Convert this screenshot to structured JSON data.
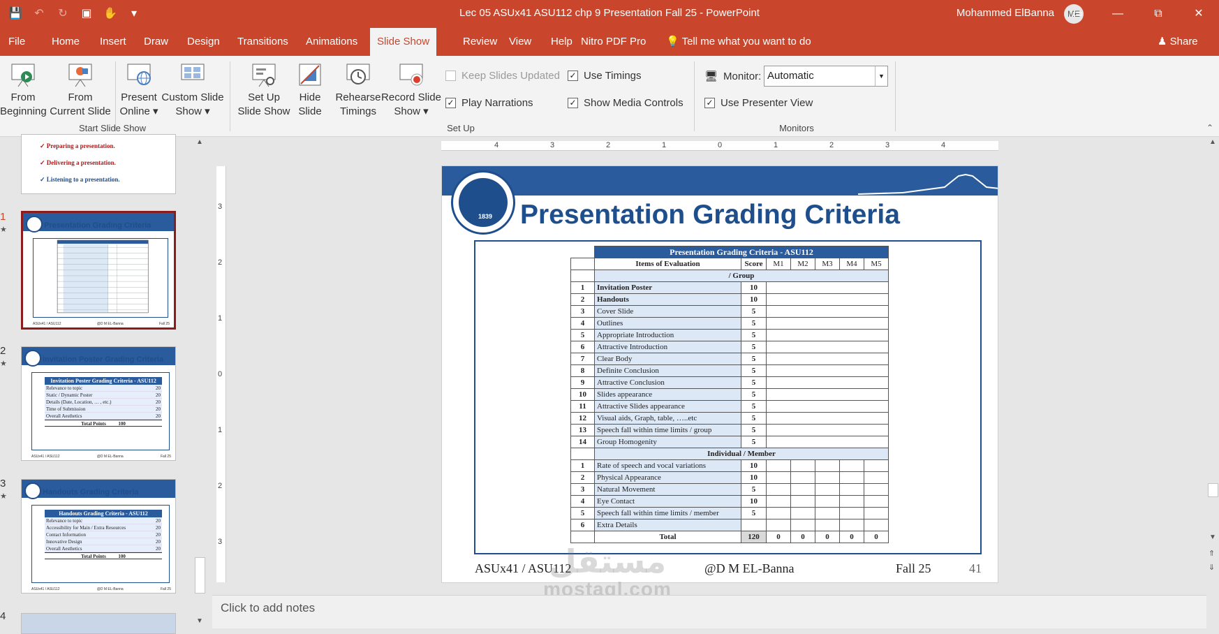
{
  "window": {
    "title": "Lec 05 ASUx41 ASU112 chp 9 Presentation Fall 25  -  PowerPoint",
    "user": "Mohammed ElBanna",
    "initials": "ME"
  },
  "tabs": [
    "File",
    "Home",
    "Insert",
    "Draw",
    "Design",
    "Transitions",
    "Animations",
    "Slide Show",
    "Review",
    "View",
    "Help",
    "Nitro PDF Pro"
  ],
  "active_tab": "Slide Show",
  "tell_me": "Tell me what you want to do",
  "share": "Share",
  "ribbon": {
    "from_beginning": [
      "From",
      "Beginning"
    ],
    "from_current": [
      "From",
      "Current Slide"
    ],
    "present_online": [
      "Present",
      "Online ▾"
    ],
    "custom_show": [
      "Custom Slide",
      "Show ▾"
    ],
    "group_start": "Start Slide Show",
    "setup_show": [
      "Set Up",
      "Slide Show"
    ],
    "hide_slide": [
      "Hide",
      "Slide"
    ],
    "rehearse": [
      "Rehearse",
      "Timings"
    ],
    "record": [
      "Record Slide",
      "Show ▾"
    ],
    "keep_updated": "Keep Slides Updated",
    "play_narrations": "Play Narrations",
    "use_timings": "Use Timings",
    "show_media": "Show Media Controls",
    "group_setup": "Set Up",
    "monitor_label": "Monitor:",
    "monitor_value": "Automatic",
    "use_presenter": "Use Presenter View",
    "group_monitors": "Monitors"
  },
  "thumbnails": {
    "prev_items": [
      "Preparing a presentation.",
      "Delivering a presentation.",
      "Listening to a presentation."
    ],
    "t41_number": "1",
    "t41_title": "Presentation Grading Criteria",
    "t42_number": "2",
    "t42_title": "Invitation Poster Grading Criteria",
    "t42_table_title": "Invitation Poster Grading Criteria - ASU112",
    "t42_rows": [
      [
        "Relevance to topic",
        "20"
      ],
      [
        "Static / Dynamic Poster",
        "20"
      ],
      [
        "Details (Date, Location, … , etc.)",
        "20"
      ],
      [
        "Time of Submission",
        "20"
      ],
      [
        "Overall Aesthetics",
        "20"
      ]
    ],
    "t42_total": [
      "Total Points",
      "100"
    ],
    "t43_number": "3",
    "t43_title": "Handouts Grading Criteria",
    "t43_table_title": "Handouts Grading Criteria - ASU112",
    "t43_rows": [
      [
        "Relevance to topic",
        "20"
      ],
      [
        "Accessibility for Main / Extra Resources",
        "20"
      ],
      [
        "Contact Information",
        "20"
      ],
      [
        "Innovative Design",
        "20"
      ],
      [
        "Overall Aesthetics",
        "20"
      ]
    ],
    "t43_total": [
      "Total Points",
      "100"
    ],
    "t44_number": "4",
    "footer": [
      "ASUx41 / ASU112",
      "@D M EL-Banna",
      "Fall 25"
    ]
  },
  "slide": {
    "title": "Presentation Grading Criteria",
    "seal_year": "1839",
    "table_caption": "Presentation Grading Criteria - ASU112",
    "headers": [
      "Items of Evaluation",
      "Score",
      "M1",
      "M2",
      "M3",
      "M4",
      "M5"
    ],
    "group_label": "/ Group",
    "group_rows": [
      [
        "1",
        "Invitation Poster",
        "10"
      ],
      [
        "2",
        "Handouts",
        "10"
      ],
      [
        "3",
        "Cover Slide",
        "5"
      ],
      [
        "4",
        "Outlines",
        "5"
      ],
      [
        "5",
        "Appropriate Introduction",
        "5"
      ],
      [
        "6",
        "Attractive Introduction",
        "5"
      ],
      [
        "7",
        "Clear Body",
        "5"
      ],
      [
        "8",
        "Definite Conclusion",
        "5"
      ],
      [
        "9",
        "Attractive Conclusion",
        "5"
      ],
      [
        "10",
        "Slides appearance",
        "5"
      ],
      [
        "11",
        "Attractive Slides appearance",
        "5"
      ],
      [
        "12",
        "Visual aids, Graph, table, …..etc",
        "5"
      ],
      [
        "13",
        "Speech fall within time limits / group",
        "5"
      ],
      [
        "14",
        "Group Homogenity",
        "5"
      ]
    ],
    "individual_label": "Individual / Member",
    "individual_rows": [
      [
        "1",
        "Rate of speech and vocal variations",
        "10"
      ],
      [
        "2",
        "Physical Appearance",
        "10"
      ],
      [
        "3",
        "Natural Movement",
        "5"
      ],
      [
        "4",
        "Eye Contact",
        "10"
      ],
      [
        "5",
        "Speech fall within time limits / member",
        "5"
      ],
      [
        "6",
        "Extra Details",
        ""
      ]
    ],
    "total_row": [
      "Total",
      "120",
      "0",
      "0",
      "0",
      "0",
      "0"
    ],
    "footer_left": "ASUx41 / ASU112",
    "footer_mid": "@D M EL-Banna",
    "footer_right": "Fall 25",
    "slide_number": "41"
  },
  "notes_placeholder": "Click to add notes",
  "watermark": {
    "arabic": "مستقل",
    "latin": "mostaql.com"
  },
  "ruler_h": [
    "4",
    "3",
    "2",
    "1",
    "0",
    "1",
    "2",
    "3",
    "4"
  ],
  "ruler_v": [
    "3",
    "2",
    "1",
    "0",
    "1",
    "2",
    "3"
  ]
}
